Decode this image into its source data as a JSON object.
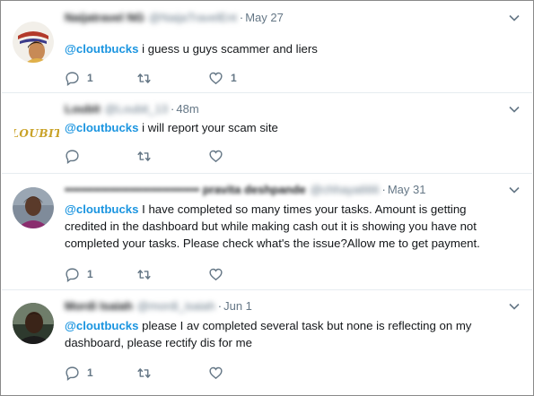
{
  "tweets": [
    {
      "name": "Naijatravel NG",
      "handle": "@NaijaTravelEnt",
      "time": "May 27",
      "mention": "@cloutbucks",
      "text": " i guess u guys scammer and liers",
      "reply_count": "1",
      "retweet_count": "",
      "like_count": "1"
    },
    {
      "name": "Loubit",
      "handle": "@Loubit_13",
      "time": "48m",
      "mention": "@cloutbucks",
      "text": " i will report your scam site",
      "reply_count": "",
      "retweet_count": "",
      "like_count": ""
    },
    {
      "name": "••••••••••••••••••••••••••••••••• pravita deshpande",
      "handle": "@chhaya666",
      "time": "May 31",
      "mention": "@cloutbucks",
      "text": "  I have completed so many times your tasks. Amount is getting credited in the dashboard but while making cash out it is showing you have not completed your tasks. Please check what's the issue?Allow me to get payment.",
      "reply_count": "1",
      "retweet_count": "",
      "like_count": ""
    },
    {
      "name": "Mordi Isaiah",
      "handle": "@mordi_isaiah",
      "time": "Jun 1",
      "mention": "@cloutbucks",
      "text": " please I av completed several task but none is reflecting on my dashboard,  please rectify dis for me",
      "reply_count": "1",
      "retweet_count": "",
      "like_count": ""
    }
  ],
  "avatar_2_text": "LOUBIT",
  "separator": "·",
  "colors": {
    "mention": "#1b95e0",
    "icon": "#657786",
    "border": "#e6ecf0"
  },
  "icons": [
    "reply-icon",
    "retweet-icon",
    "like-icon",
    "chevron-down-icon"
  ]
}
